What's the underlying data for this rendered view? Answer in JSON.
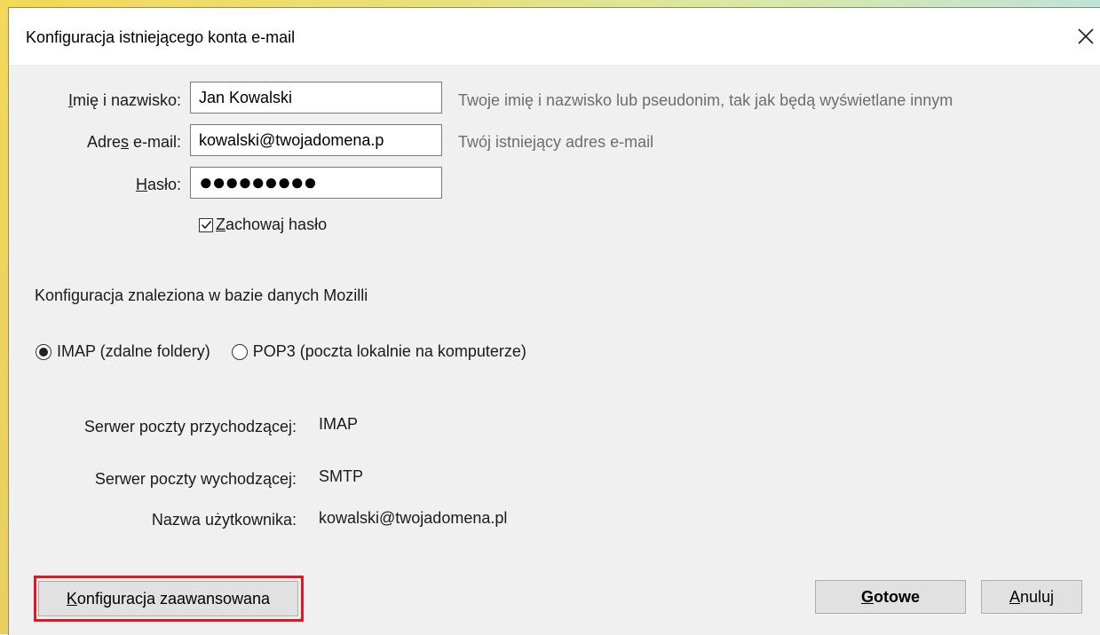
{
  "window": {
    "title": "Konfiguracja istniejącego konta e-mail"
  },
  "form": {
    "name_label_pre": "",
    "name_label_u": "I",
    "name_label_post": "mię i nazwisko:",
    "name_value": "Jan Kowalski",
    "name_hint": "Twoje imię i nazwisko lub pseudonim, tak jak będą wyświetlane innym",
    "email_label_pre": "Adre",
    "email_label_u": "s",
    "email_label_post": " e-mail:",
    "email_value": "kowalski@twojadomena.p",
    "email_hint": "Twój istniejący adres e-mail",
    "password_label_pre": "",
    "password_label_u": "H",
    "password_label_post": "asło:",
    "password_value": "●●●●●●●●●",
    "remember_u": "Z",
    "remember_rest": "achowaj hasło",
    "remember_checked": true
  },
  "config": {
    "found_text": "Konfiguracja znaleziona w bazie danych Mozilli",
    "imap_label": "IMAP (zdalne foldery)",
    "pop3_label": "POP3 (poczta lokalnie na komputerze)",
    "selected": "IMAP"
  },
  "servers": {
    "incoming_label": "Serwer poczty przychodzącej:",
    "incoming_value": "IMAP",
    "outgoing_label": "Serwer poczty wychodzącej:",
    "outgoing_value": "SMTP",
    "username_label": "Nazwa użytkownika:",
    "username_value": "kowalski@twojadomena.pl"
  },
  "buttons": {
    "advanced_u": "K",
    "advanced_rest": "onfiguracja zaawansowana",
    "done_u": "G",
    "done_rest": "otowe",
    "cancel_u": "A",
    "cancel_rest": "nuluj"
  },
  "colors": {
    "highlight": "#e8141e",
    "hint_text": "#6d6d6d"
  }
}
